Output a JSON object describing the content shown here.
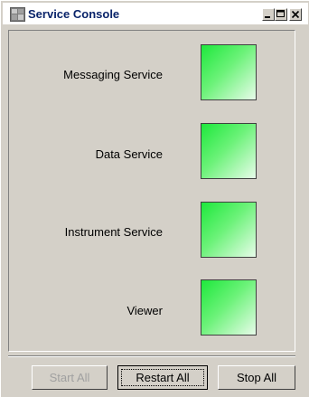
{
  "window": {
    "title": "Service Console",
    "icon": "app-icon",
    "controls": [
      "minimize-icon",
      "maximize-icon",
      "close-icon"
    ]
  },
  "services": [
    {
      "label": "Messaging Service",
      "status_color": "#2ee84a"
    },
    {
      "label": "Data Service",
      "status_color": "#2ee84a"
    },
    {
      "label": "Instrument Service",
      "status_color": "#2ee84a"
    },
    {
      "label": "Viewer",
      "status_color": "#2ee84a"
    }
  ],
  "buttons": {
    "start_all": "Start All",
    "restart_all": "Restart All",
    "stop_all": "Stop All"
  },
  "colors": {
    "window_bg": "#d4d0c8",
    "title_text": "#0a246a",
    "indicator_green": "#2ee84a"
  }
}
